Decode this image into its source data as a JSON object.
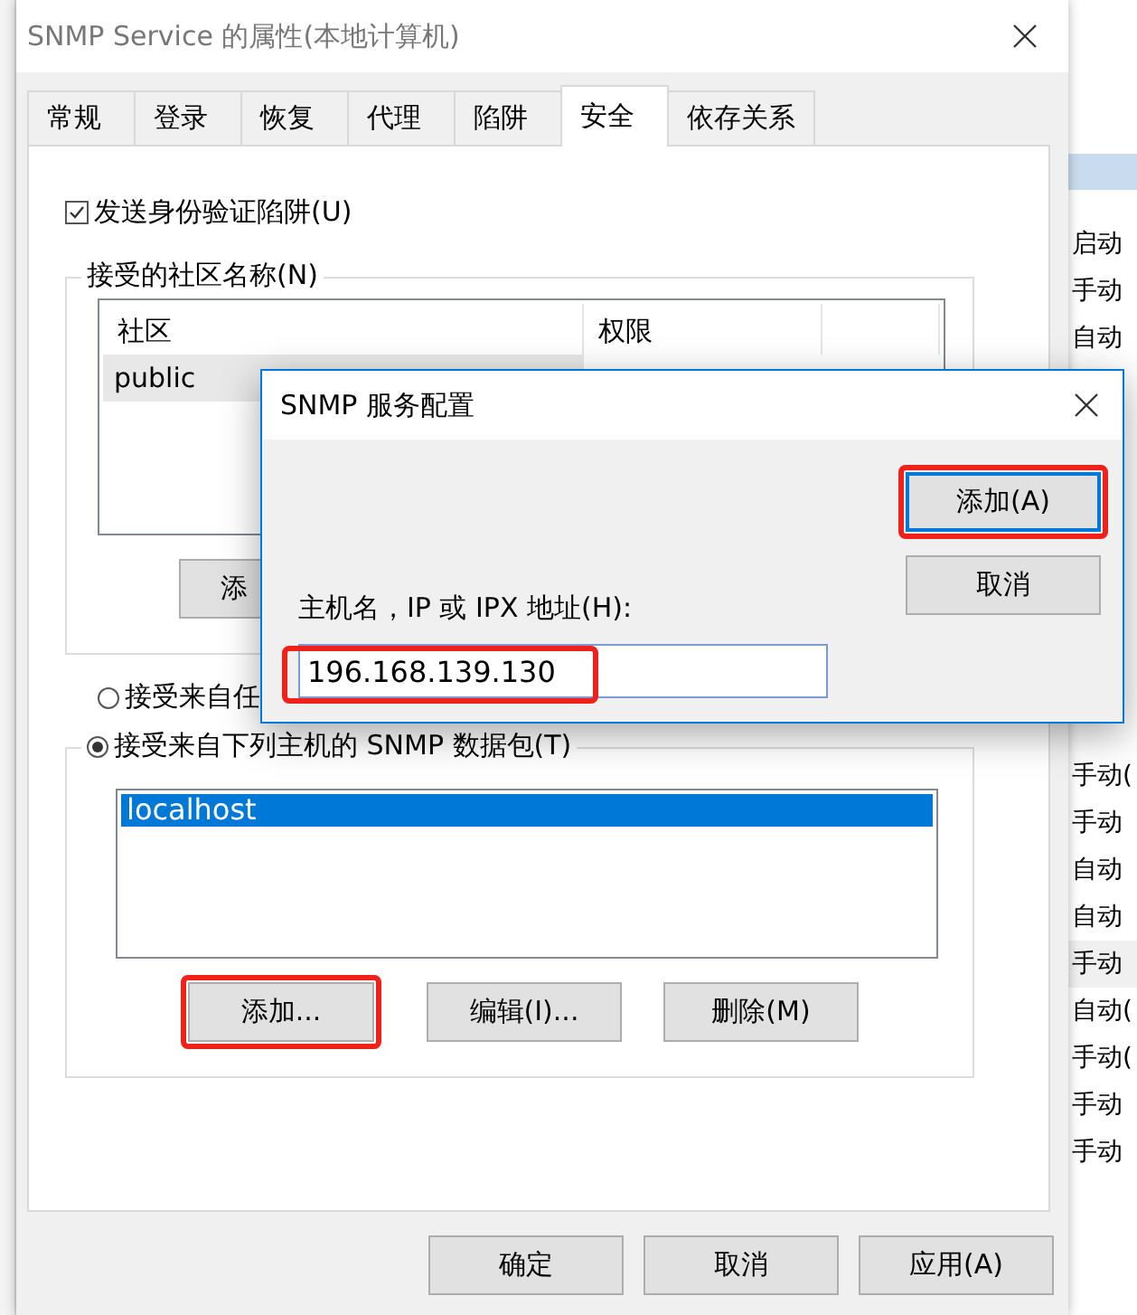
{
  "window": {
    "title": "SNMP Service 的属性(本地计算机)"
  },
  "tabs": [
    {
      "label": "常规",
      "selected": false
    },
    {
      "label": "登录",
      "selected": false
    },
    {
      "label": "恢复",
      "selected": false
    },
    {
      "label": "代理",
      "selected": false
    },
    {
      "label": "陷阱",
      "selected": false
    },
    {
      "label": "安全",
      "selected": true
    },
    {
      "label": "依存关系",
      "selected": false
    }
  ],
  "auth_trap": {
    "label": "发送身份验证陷阱(U)",
    "checked": true
  },
  "community_group": {
    "title": "接受的社区名称(N)",
    "columns": [
      "社区",
      "权限"
    ],
    "rows": [
      {
        "cells": [
          "public"
        ],
        "selected": true
      }
    ],
    "buttons": [
      "添"
    ]
  },
  "host_options": [
    {
      "label": "接受来自任",
      "selected": false
    },
    {
      "label": "接受来自下列主机的 SNMP 数据包(T)",
      "selected": true
    }
  ],
  "hosts": {
    "items": [
      {
        "label": "localhost",
        "selected": true
      }
    ],
    "buttons": [
      {
        "label": "添加...",
        "highlighted": true
      },
      {
        "label": "编辑(I)...",
        "highlighted": false
      },
      {
        "label": "删除(M)",
        "highlighted": false
      }
    ]
  },
  "footer_buttons": [
    "确定",
    "取消",
    "应用(A)"
  ],
  "service_column": {
    "upper": [
      "启动",
      "手动",
      "自动"
    ],
    "lower": [
      "手动(",
      "手动",
      "自动",
      "自动",
      "手动",
      "自动(",
      "手动(",
      "手动",
      "手动"
    ]
  },
  "dialog": {
    "title": "SNMP 服务配置",
    "buttons": [
      {
        "label": "添加(A)",
        "default": true,
        "highlighted": true
      },
      {
        "label": "取消",
        "default": false,
        "highlighted": false
      }
    ],
    "field": {
      "label": "主机名，IP 或 IPX 地址(H):",
      "value": "196.168.139.130",
      "highlighted": true
    }
  }
}
